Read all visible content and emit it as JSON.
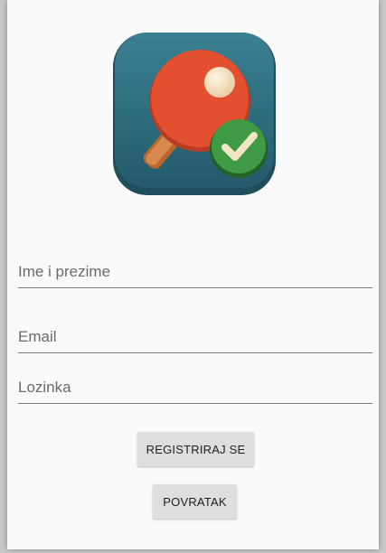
{
  "logo": {
    "name": "table-tennis-paddle-with-checkmark"
  },
  "form": {
    "full_name_placeholder": "Ime i prezime",
    "email_placeholder": "Email",
    "password_placeholder": "Lozinka"
  },
  "buttons": {
    "register_label": "REGISTRIRAJ SE",
    "back_label": "POVRATAK"
  },
  "colors": {
    "background": "#fafafa",
    "logo_tile": "#2f6f80",
    "paddle_red": "#e2502f",
    "paddle_handle": "#c8773e",
    "ball": "#f4e2c0",
    "check_circle": "#3f9a44",
    "button_bg": "#dedede",
    "underline": "#7a7a7a"
  }
}
